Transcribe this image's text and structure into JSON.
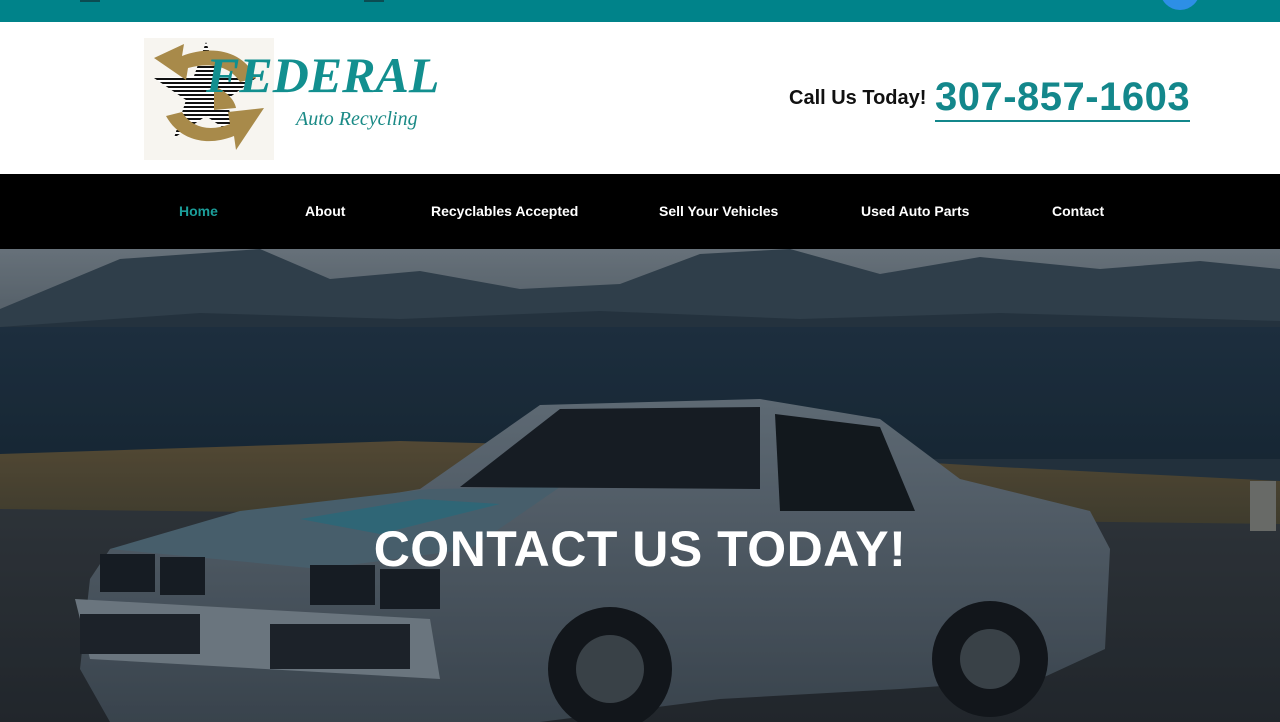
{
  "topbar": {
    "color": "#00838a",
    "icons": [
      "menu-icon",
      "menu-icon",
      "social-icon"
    ]
  },
  "logo": {
    "wordmark": "FEDERAL",
    "tagline": "Auto Recycling",
    "colors": {
      "arrow": "#a88a4a",
      "text": "#128f8f"
    }
  },
  "header": {
    "call_label": "Call Us Today!",
    "phone": "307-857-1603"
  },
  "nav": {
    "items": [
      {
        "label": "Home",
        "active": true
      },
      {
        "label": "About",
        "active": false
      },
      {
        "label": "Recyclables Accepted",
        "active": false
      },
      {
        "label": "Sell Your Vehicles",
        "active": false
      },
      {
        "label": "Used Auto Parts",
        "active": false
      },
      {
        "label": "Contact",
        "active": false
      }
    ]
  },
  "hero": {
    "title": "CONTACT US TODAY!"
  },
  "colors": {
    "accent": "#13878b",
    "nav_bg": "#000000",
    "nav_active": "#1b9e9a"
  }
}
